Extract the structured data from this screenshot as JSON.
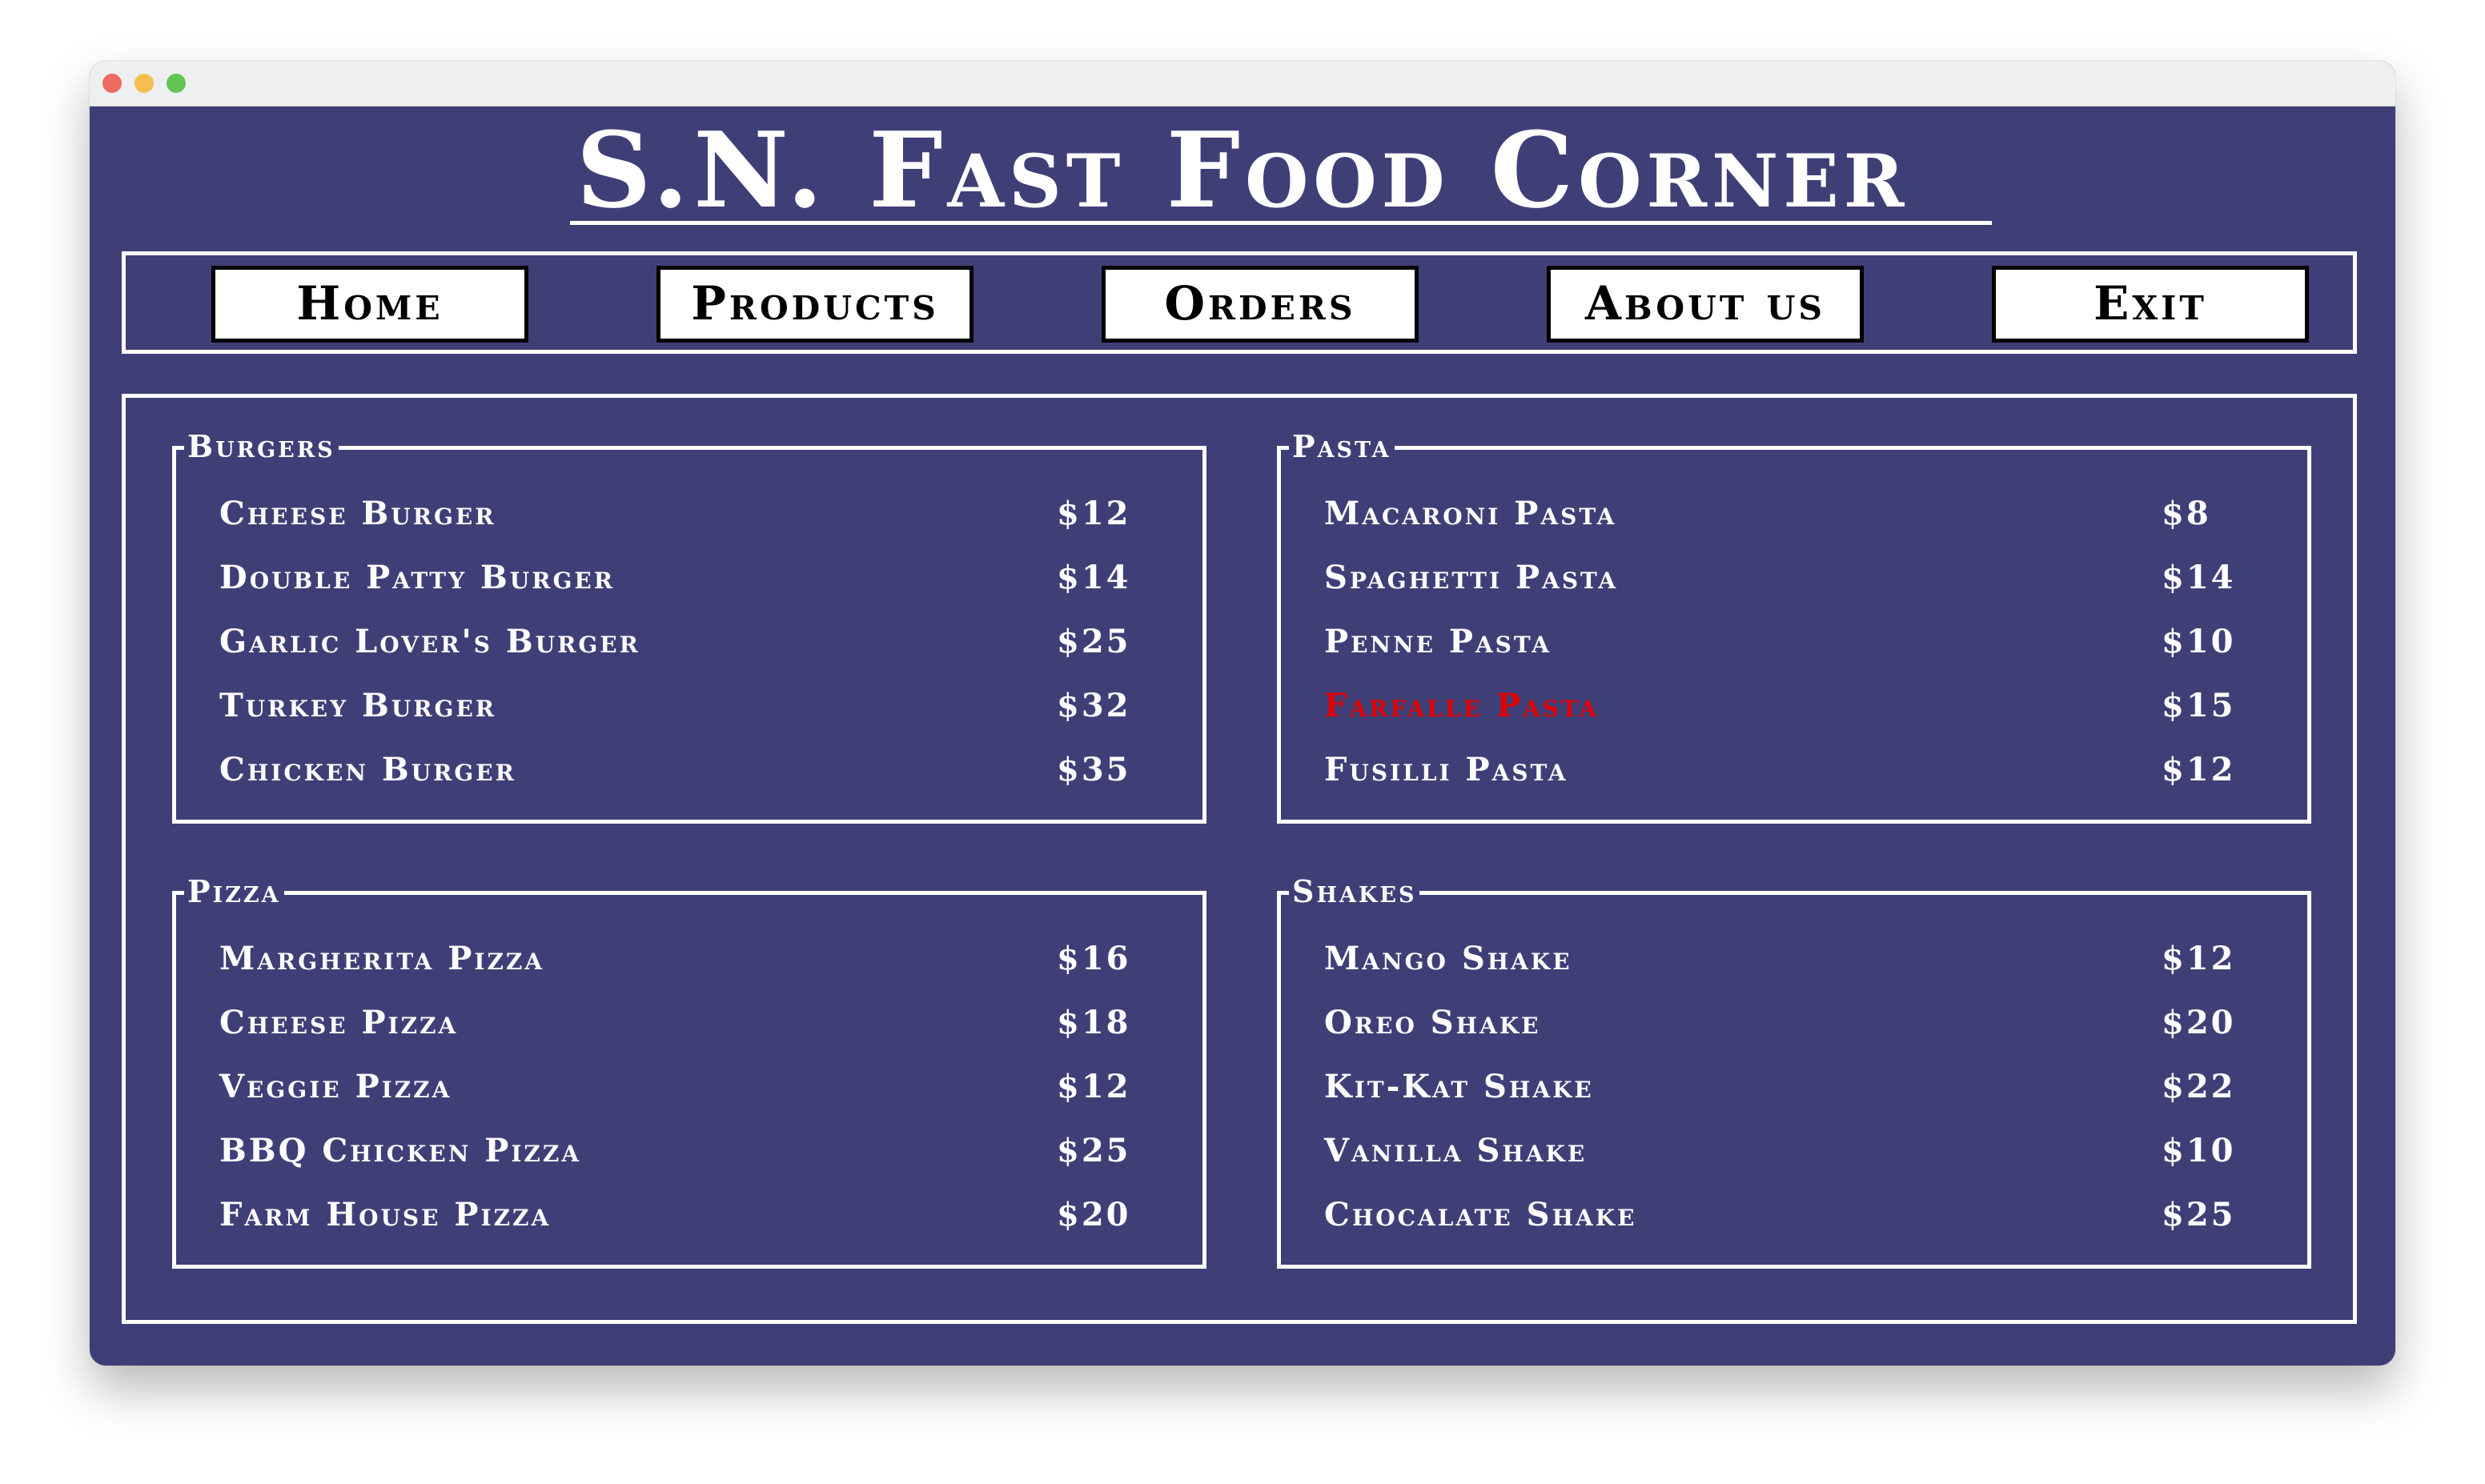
{
  "app": {
    "title": "S.N. Fast Food Corner"
  },
  "nav": {
    "items": [
      {
        "label": "Home"
      },
      {
        "label": "Products"
      },
      {
        "label": "Orders"
      },
      {
        "label": "About us"
      },
      {
        "label": "Exit"
      }
    ]
  },
  "menu": {
    "highlight_color": "#e00000",
    "background_color": "#3f3f78",
    "categories": [
      {
        "name": "Burgers",
        "items": [
          {
            "name": "Cheese Burger",
            "price": "$12"
          },
          {
            "name": "Double Patty Burger",
            "price": "$14"
          },
          {
            "name": "Garlic Lover's Burger",
            "price": "$25"
          },
          {
            "name": "Turkey Burger",
            "price": "$32"
          },
          {
            "name": "Chicken Burger",
            "price": "$35"
          }
        ]
      },
      {
        "name": "Pasta",
        "items": [
          {
            "name": "Macaroni Pasta",
            "price": "$8"
          },
          {
            "name": "Spaghetti Pasta",
            "price": "$14"
          },
          {
            "name": "Penne Pasta",
            "price": "$10"
          },
          {
            "name": "Farfalle Pasta",
            "price": "$15",
            "selected": true
          },
          {
            "name": "Fusilli Pasta",
            "price": "$12"
          }
        ]
      },
      {
        "name": "Pizza",
        "items": [
          {
            "name": "Margherita Pizza",
            "price": "$16"
          },
          {
            "name": "Cheese Pizza",
            "price": "$18"
          },
          {
            "name": "Veggie Pizza",
            "price": "$12"
          },
          {
            "name": "BBQ Chicken Pizza",
            "price": "$25"
          },
          {
            "name": "Farm House Pizza",
            "price": "$20"
          }
        ]
      },
      {
        "name": "Shakes",
        "items": [
          {
            "name": "Mango Shake",
            "price": "$12"
          },
          {
            "name": "Oreo Shake",
            "price": "$20"
          },
          {
            "name": "Kit-Kat Shake",
            "price": "$22"
          },
          {
            "name": "Vanilla Shake",
            "price": "$10"
          },
          {
            "name": "Chocalate Shake",
            "price": "$25"
          }
        ]
      }
    ]
  }
}
